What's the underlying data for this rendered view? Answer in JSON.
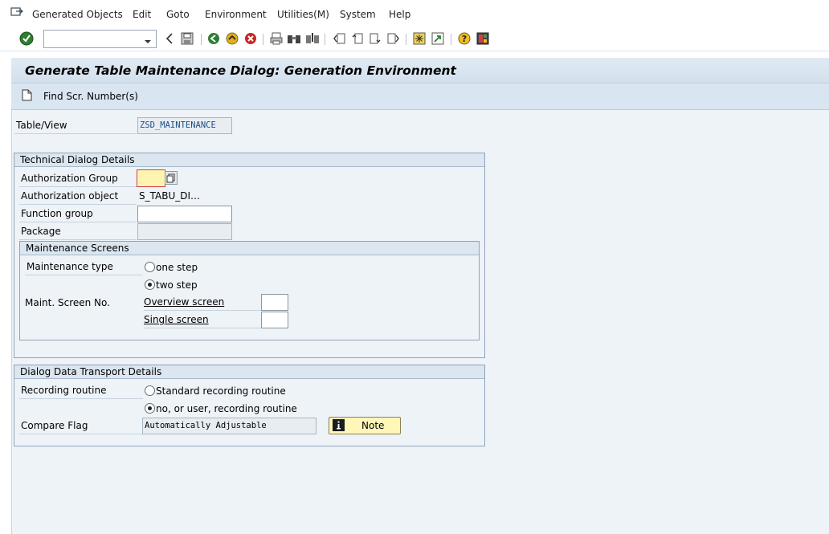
{
  "menu": {
    "items": [
      "Generated Objects",
      "Edit",
      "Goto",
      "Environment",
      "Utilities(M)",
      "System",
      "Help"
    ]
  },
  "title": "Generate Table Maintenance Dialog: Generation Environment",
  "app_toolbar": {
    "find_label": "Find Scr. Number(s)"
  },
  "fields": {
    "table_view_label": "Table/View",
    "table_view_value": "ZSD_MAINTENANCE"
  },
  "technical": {
    "heading": "Technical Dialog Details",
    "auth_group_label": "Authorization Group",
    "auth_object_label": "Authorization object",
    "auth_object_value": "S_TABU_DI…",
    "function_group_label": "Function group",
    "package_label": "Package",
    "screens": {
      "heading": "Maintenance Screens",
      "maint_type_label": "Maintenance type",
      "one_step": "one step",
      "two_step": "two step",
      "screen_no_label": "Maint. Screen No.",
      "overview_label": "Overview screen",
      "single_label": "Single screen"
    }
  },
  "transport": {
    "heading": "Dialog Data Transport Details",
    "recording_label": "Recording routine",
    "standard": "Standard recording routine",
    "no_user": "no, or user, recording routine",
    "compare_label": "Compare Flag",
    "compare_value": "Automatically Adjustable",
    "note_label": "Note"
  },
  "colors": {
    "title_bg": "#d3e0ec",
    "panel_bg": "#eef3f8",
    "required_field": "#fff5b0",
    "note_button": "#fff6b8"
  }
}
